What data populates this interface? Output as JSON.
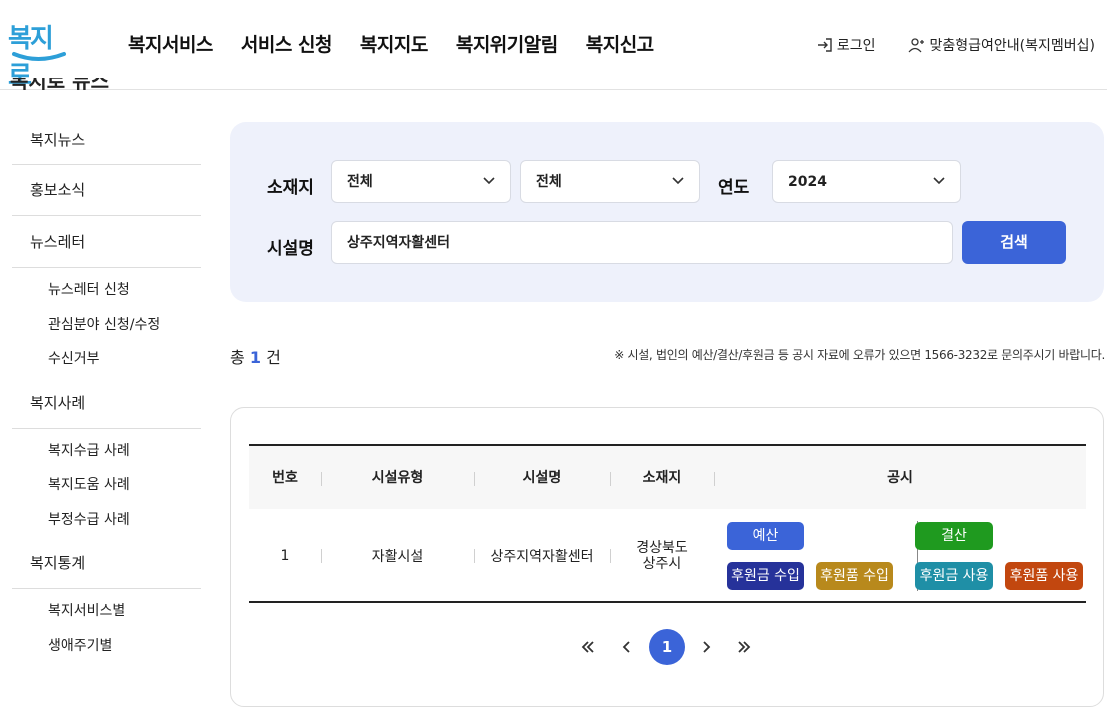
{
  "header": {
    "logo_text": "복지로",
    "nav": [
      "복지서비스",
      "서비스 신청",
      "복지지도",
      "복지위기알림",
      "복지신고"
    ],
    "login_label": "로그인",
    "custom_guide_label": "맞춤형급여안내(복지멤버십)"
  },
  "sidebar": {
    "section_title": "복지로 뉴스",
    "items": [
      {
        "label": "복지뉴스",
        "level": 1
      },
      {
        "label": "홍보소식",
        "level": 1
      },
      {
        "label": "뉴스레터",
        "level": 1
      },
      {
        "label": "뉴스레터 신청",
        "level": 2
      },
      {
        "label": "관심분야 신청/수정",
        "level": 2
      },
      {
        "label": "수신거부",
        "level": 2
      },
      {
        "label": "복지사례",
        "level": 1
      },
      {
        "label": "복지수급 사례",
        "level": 2
      },
      {
        "label": "복지도움 사례",
        "level": 2
      },
      {
        "label": "부정수급 사례",
        "level": 2
      },
      {
        "label": "복지통계",
        "level": 1
      },
      {
        "label": "복지서비스별",
        "level": 2
      },
      {
        "label": "생애주기별",
        "level": 2
      }
    ]
  },
  "search": {
    "location_label": "소재지",
    "location_value_1": "전체",
    "location_value_2": "전체",
    "year_label": "연도",
    "year_value": "2024",
    "facility_label": "시설명",
    "facility_value": "상주지역자활센터",
    "search_button": "검색"
  },
  "summary": {
    "total_prefix": "총",
    "total_count": "1",
    "total_suffix": "건",
    "notice": "※ 시설, 법인의 예산/결산/후원금 등 공시 자료에 오류가 있으면 1566-3232로 문의주시기 바랍니다."
  },
  "table": {
    "headers": [
      "번호",
      "시설유형",
      "시설명",
      "소재지",
      "공시"
    ],
    "rows": [
      {
        "no": "1",
        "type": "자활시설",
        "name": "상주지역자활센터",
        "location": "경상북도 상주시",
        "tags": {
          "budget": "예산",
          "settlement": "결산",
          "donation_income": "후원금 수입",
          "goods_income": "후원품 수입",
          "donation_use": "후원금 사용",
          "goods_use": "후원품 사용"
        }
      }
    ]
  },
  "pagination": {
    "current": "1"
  },
  "colors": {
    "accent": "#3b64d8",
    "budget": "#3b64d8",
    "settlement": "#1f9a1f",
    "donation_income": "#26329a",
    "goods_income": "#b8891c",
    "donation_use": "#1f8fa6",
    "goods_use": "#c2470f"
  }
}
